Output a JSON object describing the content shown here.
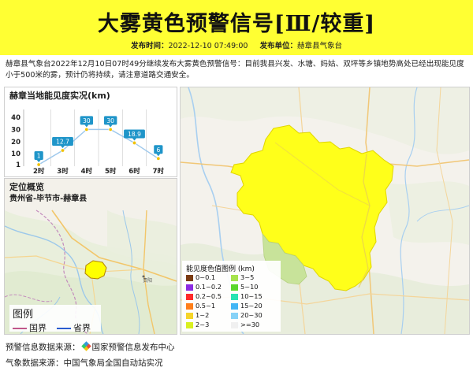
{
  "banner": {
    "title": "大雾黄色预警信号[Ⅲ/较重]",
    "publish_time_label": "发布时间：",
    "publish_time": "2022-12-10 07:49:00",
    "publisher_label": "发布单位：",
    "publisher": "赫章县气象台"
  },
  "description": "赫章县气象台2022年12月10日07时49分继续发布大雾黄色预警信号：目前我县兴发、水塘、妈姑、双坪等乡镇地势高处已经出现能见度小于500米的雾，预计仍将持续，请注意道路交通安全。",
  "visibility_panel": {
    "title": "赫章当地能见度实况(km)"
  },
  "chart_data": {
    "type": "line",
    "title": "赫章当地能见度实况(km)",
    "categories": [
      "2时",
      "3时",
      "4时",
      "5时",
      "6时",
      "7时"
    ],
    "values": [
      1,
      12.7,
      30,
      30,
      18.9,
      6
    ],
    "value_labels": [
      "1",
      "12.7",
      "30",
      "30",
      "18.9",
      "6"
    ],
    "y_ticks": [
      "40",
      "30",
      "20",
      "10",
      "1"
    ],
    "ylim": [
      1,
      40
    ],
    "colors": {
      "line": "#9ec8ec",
      "label_bg": "#1f95c9",
      "dot": "#f2c200"
    }
  },
  "location_panel": {
    "title": "定位概览",
    "subtitle": "贵州省-毕节市-赫章县",
    "city_label": "贵阳"
  },
  "small_legend": {
    "title": "图例",
    "national_border": "国界",
    "provincial_border": "省界"
  },
  "main_legend": {
    "title": "能见度色值图例 (km)",
    "items": [
      {
        "label": "0~0.1",
        "color": "#7a3b12"
      },
      {
        "label": "3~5",
        "color": "#a6e34d"
      },
      {
        "label": "0.1~0.2",
        "color": "#8b2be2"
      },
      {
        "label": "5~10",
        "color": "#5ad72a"
      },
      {
        "label": "0.2~0.5",
        "color": "#ff2a2a"
      },
      {
        "label": "10~15",
        "color": "#27e3b2"
      },
      {
        "label": "0.5~1",
        "color": "#ff7f1a"
      },
      {
        "label": "15~20",
        "color": "#43b6f5"
      },
      {
        "label": "1~2",
        "color": "#f5d52a"
      },
      {
        "label": "20~30",
        "color": "#87d2f7"
      },
      {
        "label": "2~3",
        "color": "#d9f020"
      },
      {
        "label": ">=30",
        "color": "#f0f0f0"
      }
    ]
  },
  "footer": {
    "warning_source": "预警信息数据来源：",
    "warning_source_name": "国家预警信息发布中心",
    "weather_source": "气象数据来源：中国气象局全国自动站实况"
  }
}
